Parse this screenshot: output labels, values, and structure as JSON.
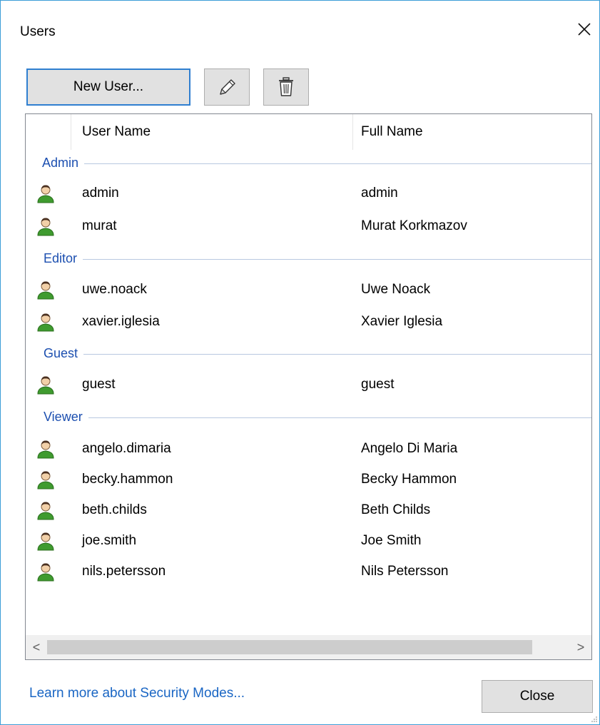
{
  "window": {
    "title": "Users",
    "close_icon": "close-icon"
  },
  "toolbar": {
    "new_user_label": "New User...",
    "edit_icon": "pencil-icon",
    "delete_icon": "trash-icon"
  },
  "table": {
    "columns": [
      "User Name",
      "Full Name"
    ],
    "groups": [
      {
        "label": "Admin",
        "users": [
          {
            "user_name": "admin",
            "full_name": "admin"
          },
          {
            "user_name": "murat",
            "full_name": "Murat Korkmazov"
          }
        ]
      },
      {
        "label": "Editor",
        "users": [
          {
            "user_name": "uwe.noack",
            "full_name": "Uwe Noack"
          },
          {
            "user_name": "xavier.iglesia",
            "full_name": "Xavier Iglesia"
          }
        ]
      },
      {
        "label": "Guest",
        "users": [
          {
            "user_name": "guest",
            "full_name": "guest"
          }
        ]
      },
      {
        "label": "Viewer",
        "users": [
          {
            "user_name": "angelo.dimaria",
            "full_name": "Angelo Di Maria"
          },
          {
            "user_name": "becky.hammon",
            "full_name": "Becky Hammon"
          },
          {
            "user_name": "beth.childs",
            "full_name": "Beth Childs"
          },
          {
            "user_name": "joe.smith",
            "full_name": "Joe Smith"
          },
          {
            "user_name": "nils.petersson",
            "full_name": "Nils Petersson"
          }
        ]
      }
    ]
  },
  "scrollbar": {
    "left_arrow": "<",
    "right_arrow": ">"
  },
  "footer": {
    "learn_more_link": "Learn more about Security Modes...",
    "close_label": "Close"
  },
  "colors": {
    "window_border": "#3c9ed8",
    "group_label": "#1c4fb0",
    "link": "#1a66c4",
    "button_face": "#e1e1e1",
    "default_button_border": "#2f7fd0"
  }
}
